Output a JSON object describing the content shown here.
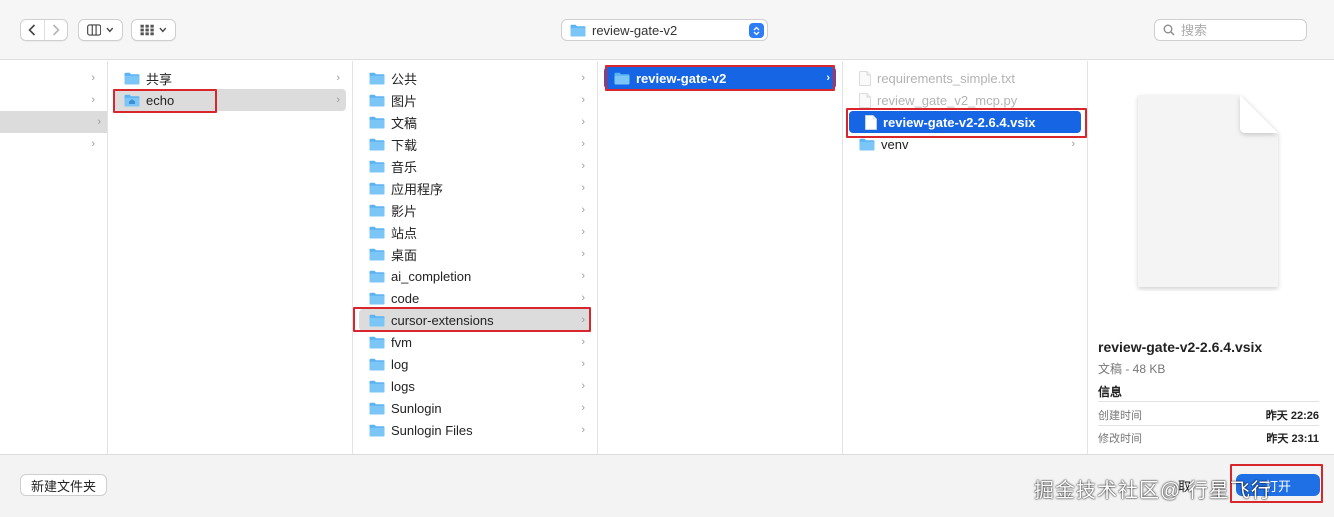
{
  "toolbar": {
    "current_folder": "review-gate-v2",
    "search_placeholder": "搜索",
    "icons": [
      "chevron-left-icon",
      "chevron-right-icon",
      "columns-view-icon",
      "chevron-down-icon",
      "grid-view-icon",
      "folder-icon",
      "stepper-icon",
      "search-icon"
    ]
  },
  "column1": {
    "items": [
      {
        "label": "共享",
        "type": "folder",
        "chevron": true
      },
      {
        "label": "echo",
        "type": "home-folder",
        "chevron": true,
        "selected": true
      }
    ]
  },
  "column2": {
    "items": [
      {
        "label": "公共",
        "chevron": true
      },
      {
        "label": "图片",
        "chevron": true
      },
      {
        "label": "文稿",
        "chevron": true
      },
      {
        "label": "下载",
        "chevron": true
      },
      {
        "label": "音乐",
        "chevron": true
      },
      {
        "label": "应用程序",
        "chevron": true
      },
      {
        "label": "影片",
        "chevron": true
      },
      {
        "label": "站点",
        "chevron": true
      },
      {
        "label": "桌面",
        "chevron": true
      },
      {
        "label": "ai_completion",
        "chevron": true
      },
      {
        "label": "code",
        "chevron": true
      },
      {
        "label": "cursor-extensions",
        "chevron": true,
        "selected": true
      },
      {
        "label": "fvm",
        "chevron": true
      },
      {
        "label": "log",
        "chevron": true
      },
      {
        "label": "logs",
        "chevron": true
      },
      {
        "label": "Sunlogin",
        "chevron": true
      },
      {
        "label": "Sunlogin Files",
        "chevron": true
      }
    ]
  },
  "column3": {
    "items": [
      {
        "label": "review-gate-v2",
        "chevron": true,
        "selected": true
      }
    ]
  },
  "column4": {
    "items": [
      {
        "label": "requirements_simple.txt",
        "type": "doc",
        "dim": true
      },
      {
        "label": "review_gate_v2_mcp.py",
        "type": "doc",
        "dim": true
      },
      {
        "label": "review-gate-v2-2.6.4.vsix",
        "type": "doc",
        "selected": true
      },
      {
        "label": "venv",
        "type": "folder",
        "chevron": true
      }
    ]
  },
  "preview": {
    "file_name": "review-gate-v2-2.6.4.vsix",
    "kind_size": "文稿 - 48 KB",
    "info_title": "信息",
    "created_label": "创建时间",
    "created_value": "昨天 22:26",
    "modified_label": "修改时间",
    "modified_value": "昨天 23:11"
  },
  "bottom": {
    "new_folder_label": "新建文件夹",
    "watermark": "掘金技术社区@ 行星飞行",
    "cancel_label_partial": "取",
    "open_label": "打开"
  },
  "colors": {
    "selection_blue": "#1565e4",
    "folder_blue": "#5bb4f2",
    "highlight_red": "#d8262c"
  }
}
